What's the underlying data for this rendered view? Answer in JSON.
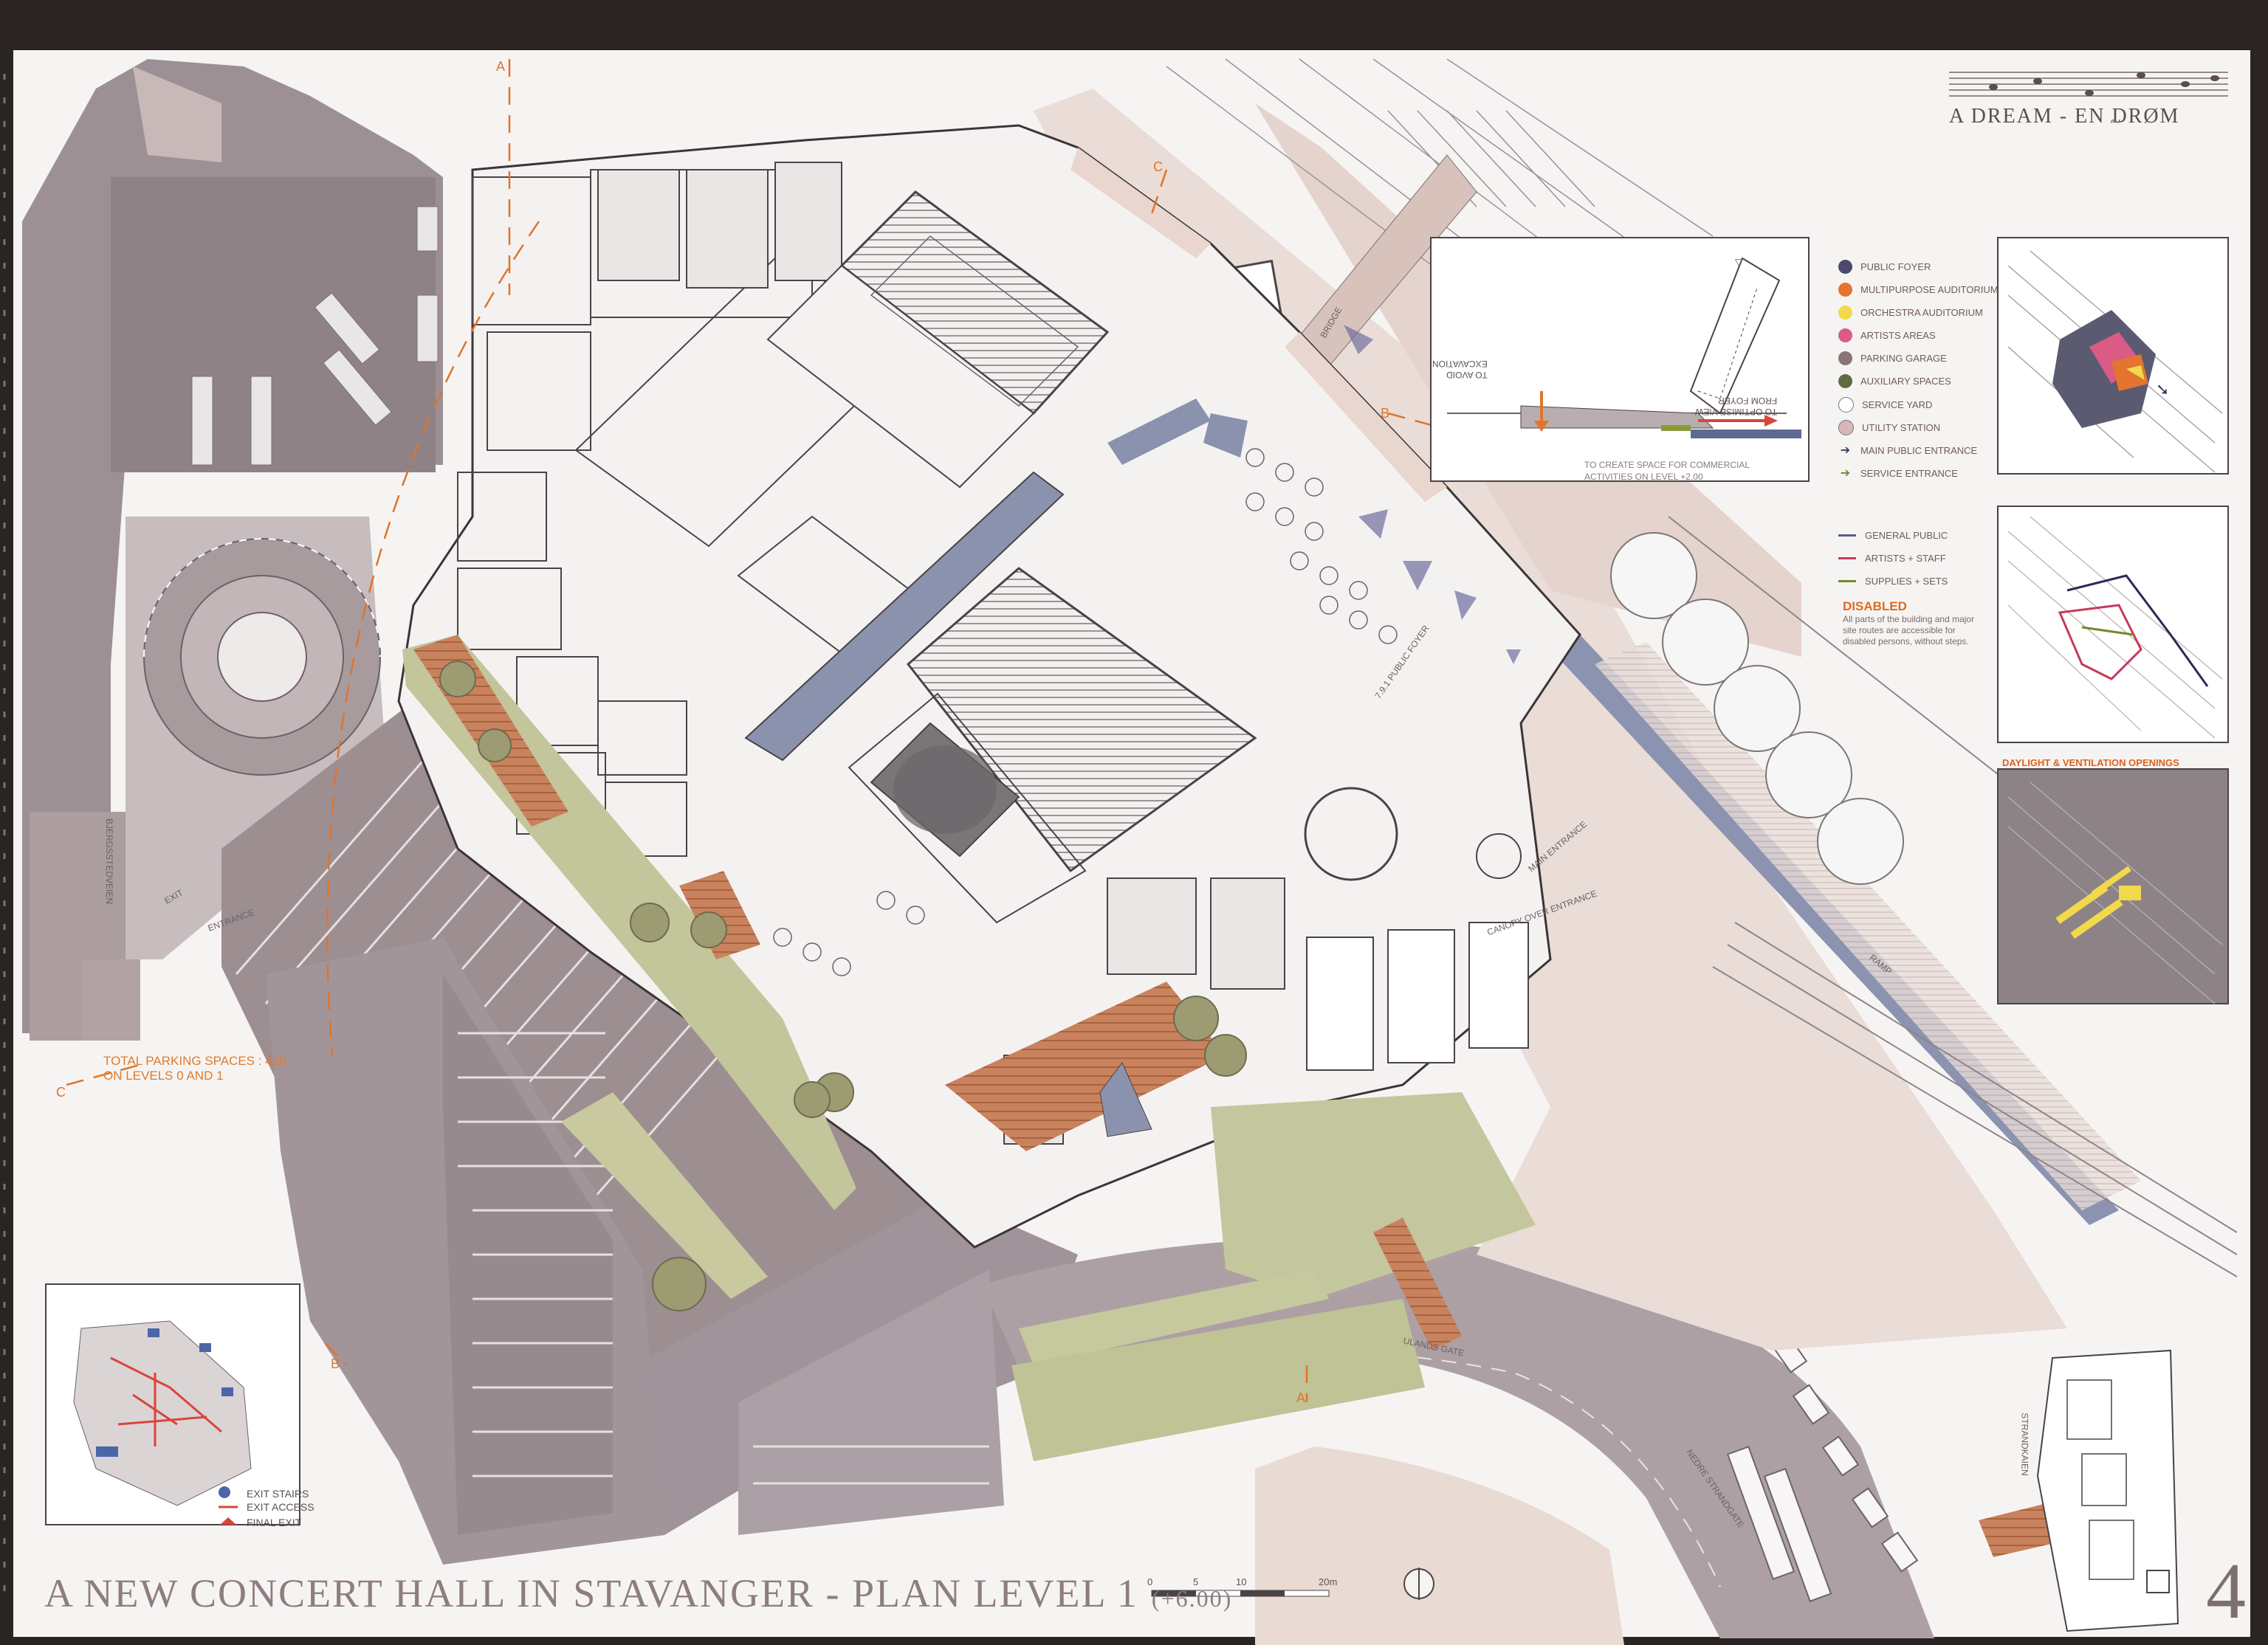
{
  "title": {
    "main": "A NEW CONCERT HALL IN STAVANGER - PLAN LEVEL 1",
    "level": "(+6.00)",
    "sheet_number": "4"
  },
  "motto": {
    "text": "A DREAM - EN DRØM"
  },
  "legend_areas": [
    {
      "label": "PUBLIC FOYER",
      "color": "#4b4a6e"
    },
    {
      "label": "MULTIPURPOSE AUDITORIUM",
      "color": "#e4742f"
    },
    {
      "label": "ORCHESTRA AUDITORIUM",
      "color": "#f2d84a"
    },
    {
      "label": "ARTISTS AREAS",
      "color": "#d95b86"
    },
    {
      "label": "PARKING GARAGE",
      "color": "#8a7577"
    },
    {
      "label": "AUXILIARY SPACES",
      "color": "#5f6c43"
    },
    {
      "label": "SERVICE YARD",
      "color": "#ffffff"
    },
    {
      "label": "UTILITY STATION",
      "color": "#d9b6b8"
    },
    {
      "label": "MAIN PUBLIC ENTRANCE",
      "icon": "arrow-icon"
    },
    {
      "label": "SERVICE ENTRANCE",
      "icon": "arrow-icon"
    }
  ],
  "legend_routes": [
    {
      "label": "GENERAL PUBLIC",
      "color": "#5a5a88"
    },
    {
      "label": "ARTISTS + STAFF",
      "color": "#c53a5a"
    },
    {
      "label": "SUPPLIES + SETS",
      "color": "#6f8a2a"
    }
  ],
  "disabled": {
    "heading": "DISABLED",
    "text": "All parts of the building and major site routes are accessible for disabled persons, without steps."
  },
  "daylight_label": "DAYLIGHT & VENTILATION OPENINGS",
  "parking_note": {
    "line1": "TOTAL PARKING SPACES : 428",
    "line2": "ON LEVELS 0 AND 1"
  },
  "section_notes": {
    "commercial": [
      "TO CREATE SPACE FOR COMMERCIAL",
      "ACTIVITIES ON LEVEL +2.00"
    ],
    "view": [
      "TO OPTIMISE VIEW",
      "FROM FOYER"
    ],
    "excavation": [
      "TO AVOID",
      "EXCAVATION"
    ]
  },
  "exit_legend": [
    {
      "label": "EXIT STAIRS"
    },
    {
      "label": "EXIT ACCESS"
    },
    {
      "label": "FINAL EXIT"
    }
  ],
  "scale_bar": {
    "labels": [
      "0",
      "5",
      "10",
      "20m"
    ]
  },
  "road_labels": {
    "ulands_gate": "ULANDS GATE",
    "nedre_strandgate": "NEDRE STRANDGATE",
    "strandkaien": "STRANDKAIEN",
    "bjergsstedveien": "BJERGSSTEDVEIEN"
  },
  "plan_labels": {
    "main_entrance": "MAIN ENTRANCE",
    "public_foyer": "7.9.1 PUBLIC FOYER",
    "canopy": "CANOPY OVER ENTRANCE",
    "bridge": "BRIDGE",
    "ramp": "RAMP",
    "exit": "EXIT",
    "entrance": "ENTRANCE"
  }
}
